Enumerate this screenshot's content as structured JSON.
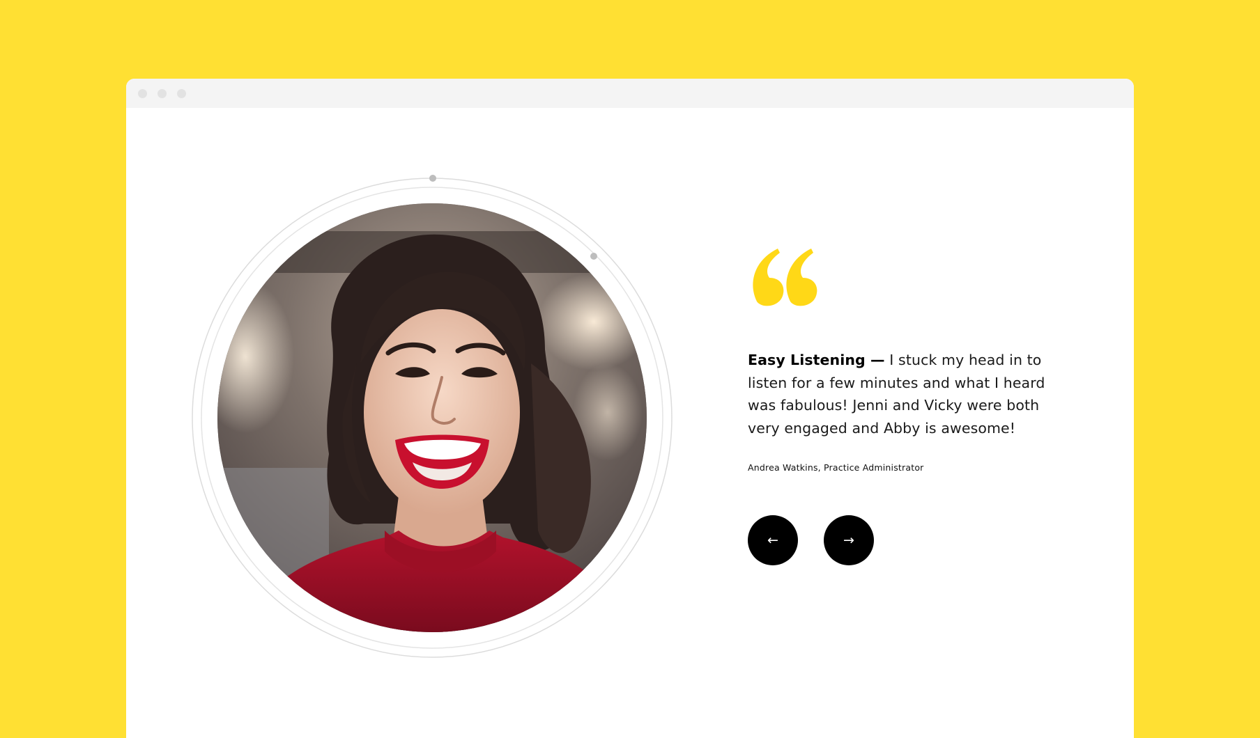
{
  "colors": {
    "background": "#FFE033",
    "accent": "#FFD817",
    "window": "#FFFFFF",
    "titlebar": "#F4F4F4",
    "nav_button": "#000000",
    "ring": "#DCDCDC"
  },
  "window": {
    "controls": [
      "window-dot",
      "window-dot",
      "window-dot"
    ]
  },
  "testimonial": {
    "quote_icon": "quote-mark-icon",
    "headline": "Easy Listening —",
    "body": "I stuck my head in to listen for a few minutes and what I heard was fabulous! Jenni and Vicky were both very engaged and Abby is awesome!",
    "author": "Andrea Watkins, Practice Administrator",
    "photo_alt": "portrait-photo"
  },
  "navigation": {
    "prev_label": "←",
    "next_label": "→",
    "prev_icon": "arrow-left-icon",
    "next_icon": "arrow-right-icon"
  }
}
